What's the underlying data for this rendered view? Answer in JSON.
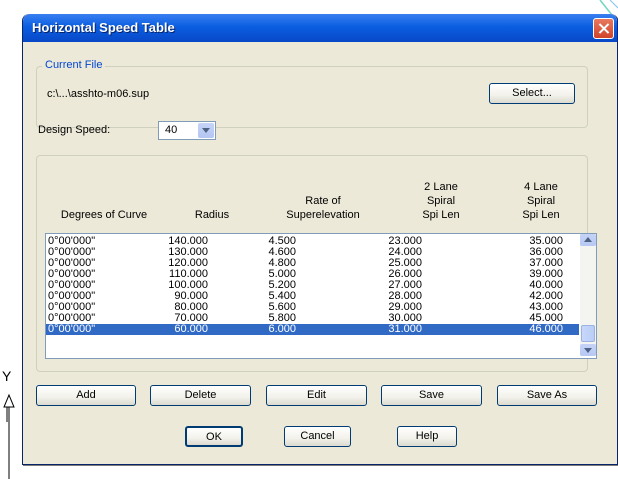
{
  "window": {
    "title": "Horizontal Speed Table"
  },
  "current_file": {
    "legend": "Current File",
    "path": "c:\\...\\asshto-m06.sup",
    "select_label": "Select..."
  },
  "design_speed": {
    "label": "Design Speed:",
    "value": "40"
  },
  "table": {
    "headers": {
      "degree": "Degrees of Curve",
      "radius": "Radius",
      "rate_line1": "Rate of",
      "rate_line2": "Superelevation",
      "lane2_line1": "2 Lane",
      "lane2_line2": "Spiral",
      "lane2_line3": "Spi Len",
      "lane4_line1": "4 Lane",
      "lane4_line2": "Spiral",
      "lane4_line3": "Spi Len"
    },
    "rows": [
      {
        "degree": "0°00'000\"",
        "radius": "140.000",
        "rate": "4.500",
        "lane2": "23.000",
        "lane4": "35.000"
      },
      {
        "degree": "0°00'000\"",
        "radius": "130.000",
        "rate": "4.600",
        "lane2": "24.000",
        "lane4": "36.000"
      },
      {
        "degree": "0°00'000\"",
        "radius": "120.000",
        "rate": "4.800",
        "lane2": "25.000",
        "lane4": "37.000"
      },
      {
        "degree": "0°00'000\"",
        "radius": "110.000",
        "rate": "5.000",
        "lane2": "26.000",
        "lane4": "39.000"
      },
      {
        "degree": "0°00'000\"",
        "radius": "100.000",
        "rate": "5.200",
        "lane2": "27.000",
        "lane4": "40.000"
      },
      {
        "degree": "0°00'000\"",
        "radius": "90.000",
        "rate": "5.400",
        "lane2": "28.000",
        "lane4": "42.000"
      },
      {
        "degree": "0°00'000\"",
        "radius": "80.000",
        "rate": "5.600",
        "lane2": "29.000",
        "lane4": "43.000"
      },
      {
        "degree": "0°00'000\"",
        "radius": "70.000",
        "rate": "5.800",
        "lane2": "30.000",
        "lane4": "45.000"
      },
      {
        "degree": "0°00'000\"",
        "radius": "60.000",
        "rate": "6.000",
        "lane2": "31.000",
        "lane4": "46.000",
        "selected": true
      }
    ]
  },
  "actions": {
    "add": "Add",
    "delete": "Delete",
    "edit": "Edit",
    "save": "Save",
    "save_as": "Save As"
  },
  "footer": {
    "ok": "OK",
    "cancel": "Cancel",
    "help": "Help"
  },
  "background": {
    "axis_label": "Y"
  },
  "colors": {
    "title_bar": "#0a5ee0",
    "selection": "#316ac5",
    "legend_text": "#0046d5",
    "close_button": "#d1432a"
  },
  "icons": {
    "close": "close-icon",
    "dropdown": "chevron-down-icon",
    "axis": "ucs-y-axis-icon"
  }
}
